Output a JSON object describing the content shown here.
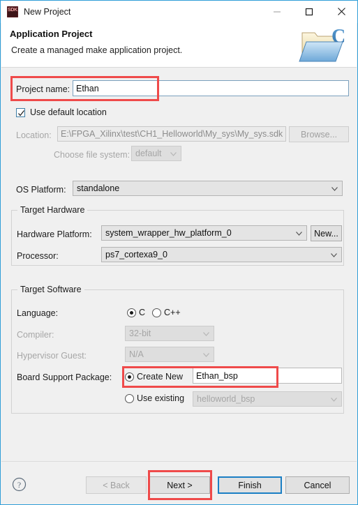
{
  "window": {
    "title": "New Project",
    "app_icon": "sdk-icon",
    "app_icon_text": "SDK",
    "controls": {
      "minimize": "minimize-icon",
      "maximize": "maximize-icon",
      "close": "close-icon"
    }
  },
  "header": {
    "title": "Application Project",
    "subtitle": "Create a managed make application project.",
    "icon": "c-project-folder-icon"
  },
  "form": {
    "project_name_label": "Project name:",
    "project_name_value": "Ethan",
    "use_default_location_label": "Use default location",
    "use_default_location_checked": true,
    "location_label": "Location:",
    "location_value": "E:\\FPGA_Xilinx\\test\\CH1_Helloworld\\My_sys\\My_sys.sdk",
    "browse_label": "Browse...",
    "choose_file_system_label": "Choose file system:",
    "choose_file_system_value": "default",
    "os_platform_label": "OS Platform:",
    "os_platform_value": "standalone"
  },
  "target_hardware": {
    "group_title": "Target Hardware",
    "hardware_platform_label": "Hardware Platform:",
    "hardware_platform_value": "system_wrapper_hw_platform_0",
    "new_button_label": "New...",
    "processor_label": "Processor:",
    "processor_value": "ps7_cortexa9_0"
  },
  "target_software": {
    "group_title": "Target Software",
    "language_label": "Language:",
    "language_options": [
      "C",
      "C++"
    ],
    "language_selected": "C",
    "compiler_label": "Compiler:",
    "compiler_value": "32-bit",
    "hypervisor_label": "Hypervisor Guest:",
    "hypervisor_value": "N/A",
    "bsp_label": "Board Support Package:",
    "bsp_create_new_label": "Create New",
    "bsp_create_new_value": "Ethan_bsp",
    "bsp_create_new_selected": true,
    "bsp_use_existing_label": "Use existing",
    "bsp_use_existing_value": "helloworld_bsp"
  },
  "footer": {
    "help_icon": "help-icon",
    "back_label": "< Back",
    "next_label": "Next >",
    "finish_label": "Finish",
    "cancel_label": "Cancel"
  },
  "colors": {
    "window_border": "#2f9ed8",
    "highlight": "#ef4a4a",
    "default_button_border": "#1b7fc4",
    "body_bg": "#f0f0f0"
  }
}
